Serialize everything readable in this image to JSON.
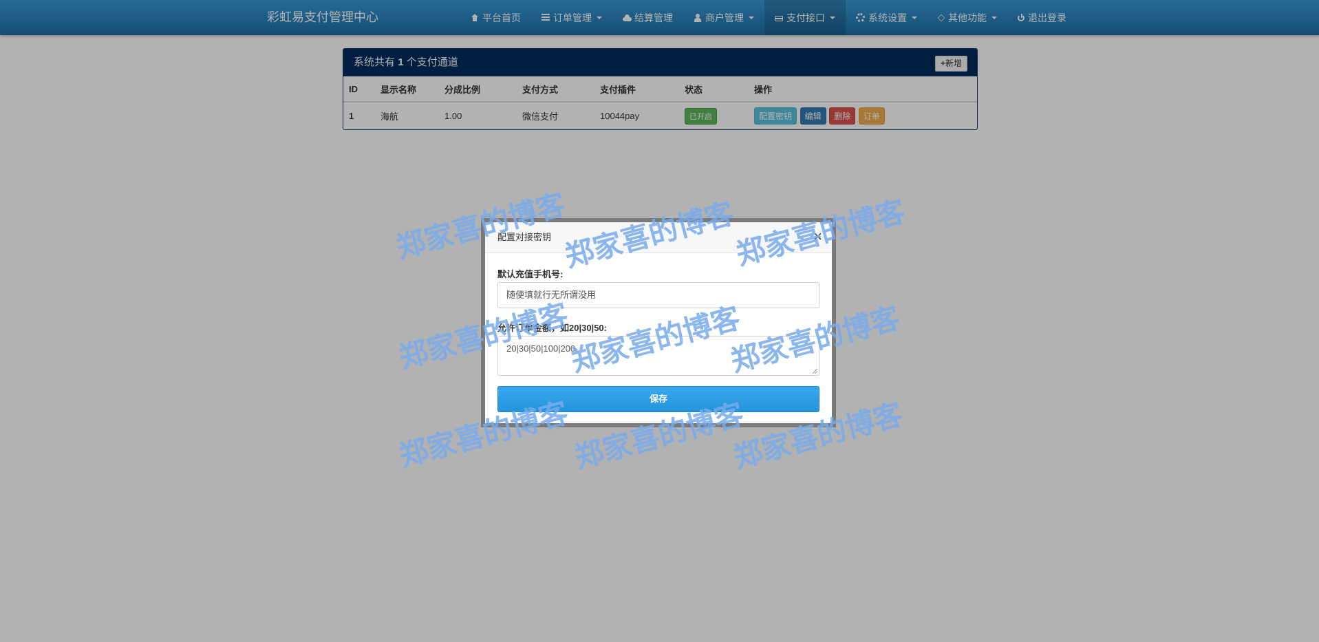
{
  "navbar": {
    "brand": "彩虹易支付管理中心",
    "items": [
      {
        "icon": "home-icon",
        "label": "平台首页",
        "dropdown": false
      },
      {
        "icon": "list-icon",
        "label": "订单管理",
        "dropdown": true
      },
      {
        "icon": "cloud-icon",
        "label": "结算管理",
        "dropdown": false
      },
      {
        "icon": "user-icon",
        "label": "商户管理",
        "dropdown": true
      },
      {
        "icon": "credit-card-icon",
        "label": "支付接口",
        "dropdown": true,
        "active": true
      },
      {
        "icon": "gear-icon",
        "label": "系统设置",
        "dropdown": true
      },
      {
        "icon": "cube-icon",
        "label": "其他功能",
        "dropdown": true
      },
      {
        "icon": "power-icon",
        "label": "退出登录",
        "dropdown": false
      }
    ]
  },
  "panel": {
    "title_prefix": "系统共有",
    "title_count": "1",
    "title_suffix": "个支付通道",
    "add_button": "新增",
    "add_icon": "plus-icon",
    "columns": [
      "ID",
      "显示名称",
      "分成比例",
      "支付方式",
      "支付插件",
      "状态",
      "操作"
    ],
    "rows": [
      {
        "id": "1",
        "name": "海航",
        "ratio": "1.00",
        "method": "微信支付",
        "plugin": "10044pay",
        "status": "已开启",
        "status_color": "#5cb85c",
        "actions": [
          "配置密钥",
          "编辑",
          "删除",
          "订单"
        ]
      }
    ]
  },
  "modal": {
    "title": "配置对接密钥",
    "close": "×",
    "phone_label": "默认充值手机号:",
    "phone_value": "随便填就行无所谓没用",
    "amount_label": "允许订单金额，如20|30|50:",
    "amount_value": "20|30|50|100|200",
    "save_button": "保存"
  },
  "watermark": {
    "text": "郑家喜的博客",
    "color": "#78aaeb"
  }
}
